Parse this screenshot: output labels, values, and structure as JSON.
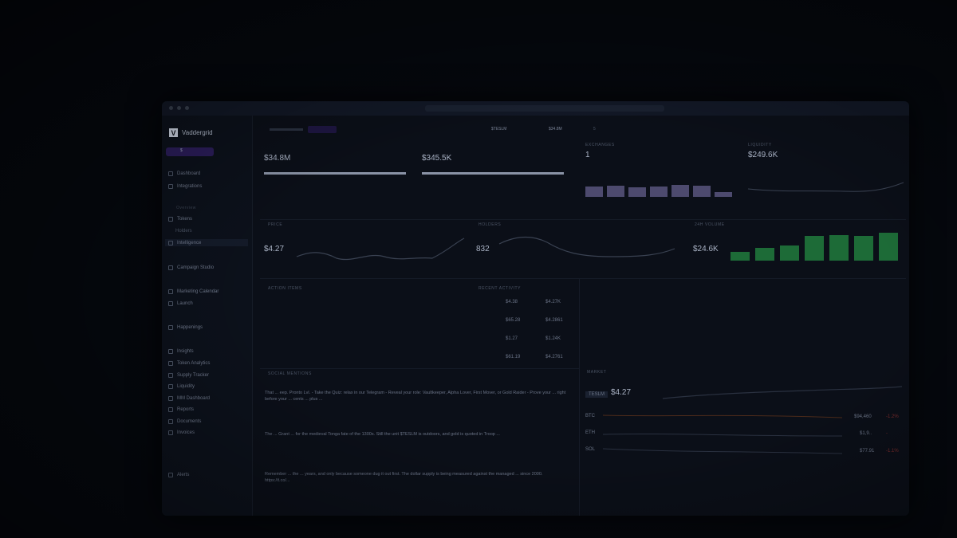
{
  "app": {
    "name": "Vaddergrid",
    "token_label": "$",
    "ticker": "$TESLM",
    "mcap_chip": "$34.8M",
    "counter": "5"
  },
  "sidebar": {
    "items": [
      {
        "label": "Dashboard"
      },
      {
        "label": "Integrations"
      },
      {
        "label": "Overview"
      },
      {
        "label": "Tokens"
      },
      {
        "label": "Holders"
      },
      {
        "label": "Intelligence"
      },
      {
        "label": "Campaign Studio"
      },
      {
        "label": "Marketing Calendar"
      },
      {
        "label": "Launch"
      },
      {
        "label": "Happenings"
      },
      {
        "label": "Insights"
      },
      {
        "label": "Token Analytics"
      },
      {
        "label": "Supply Tracker"
      },
      {
        "label": "Liquidity"
      },
      {
        "label": "MM Dashboard"
      },
      {
        "label": "Reports"
      },
      {
        "label": "Documents"
      },
      {
        "label": "Invoices"
      },
      {
        "label": "Alerts"
      }
    ]
  },
  "stats": {
    "mcap": {
      "value": "$34.8M"
    },
    "fdv": {
      "value": "$345.5K"
    },
    "exchanges": {
      "label": "EXCHANGES",
      "value": "1"
    },
    "liquidity": {
      "label": "LIQUIDITY",
      "value": "$249.6K"
    }
  },
  "cards": {
    "price": {
      "label": "PRICE",
      "value": "$4.27"
    },
    "holders": {
      "label": "HOLDERS",
      "value": "832"
    },
    "volume": {
      "label": "24H VOLUME",
      "value": "$24.6K",
      "bars": [
        0.3,
        0.45,
        0.52,
        0.85,
        0.88,
        0.85,
        0.98
      ]
    }
  },
  "panels": {
    "action_items": {
      "label": "ACTION ITEMS"
    },
    "recent_activity": {
      "label": "RECENT ACTIVITY",
      "rows": [
        {
          "value": "$4.27K",
          "amount": "$4.38"
        },
        {
          "value": "$4.2861",
          "amount": "$65.28"
        },
        {
          "value": "$1.24K",
          "amount": "$1.27"
        },
        {
          "value": "$4.2761",
          "amount": "$61.19"
        }
      ]
    },
    "social": {
      "label": "SOCIAL MENTIONS",
      "posts": [
        {
          "text": "That ... eep. Pronto Lvl. - Take the Quiz: relax in our Telegram - Reveal your role: Vaultkeeper, Alpha Lover, First Mover, or Gold Raider - Prove your ... right before your ... cents ... plus ..."
        },
        {
          "text": "The ... Grant ... for the medieval Tonga fate of the 1300s. Still the unit $TESLM is outdoors, and gold is quoted in Troop ..."
        },
        {
          "text": "Remember ... the ... years, and only because someone dug it out first. The dollar supply is being measured against the managed ... since 2000. https://t.co/..."
        }
      ]
    },
    "market": {
      "label": "MARKET",
      "pair": "TESLM",
      "price": "$4.27",
      "rows": [
        {
          "sym": "BTC",
          "val": "$94,460",
          "chg": "-1.2%"
        },
        {
          "sym": "ETH",
          "val": "$1,9..",
          "chg": "-"
        },
        {
          "sym": "SOL",
          "val": "$77.91",
          "chg": "-1.1%"
        }
      ]
    }
  },
  "colors": {
    "accent": "#2b1d5a",
    "green": "#1d6b37",
    "bg": "#05080e"
  }
}
